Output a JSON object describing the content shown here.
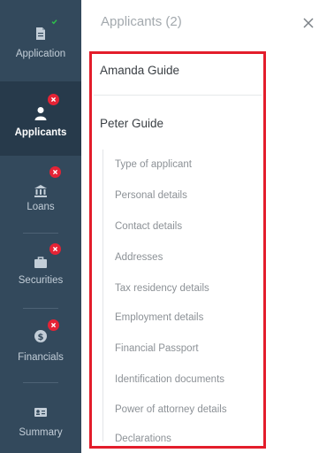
{
  "sidebar": {
    "items": [
      {
        "label": "Application",
        "icon": "document-icon",
        "status": "complete"
      },
      {
        "label": "Applicants",
        "icon": "person-icon",
        "status": "error"
      },
      {
        "label": "Loans",
        "icon": "bank-icon",
        "status": "error"
      },
      {
        "label": "Securities",
        "icon": "briefcase-icon",
        "status": "error"
      },
      {
        "label": "Financials",
        "icon": "money-icon",
        "status": "error"
      },
      {
        "label": "Summary",
        "icon": "id-card-icon",
        "status": "none"
      }
    ]
  },
  "panel": {
    "title": "Applicants (2)",
    "applicants": [
      {
        "name": "Amanda Guide"
      },
      {
        "name": "Peter Guide"
      }
    ],
    "sections": [
      "Type of applicant",
      "Personal details",
      "Contact details",
      "Addresses",
      "Tax residency details",
      "Employment details",
      "Financial Passport",
      "Identification documents",
      "Power of attorney details",
      "Declarations"
    ]
  },
  "colors": {
    "sidebar_bg": "#33495c",
    "sidebar_active_bg": "#273a4b",
    "error_badge": "#e52335",
    "complete_badge": "#2ec54a",
    "highlight_border": "#e31d2b"
  }
}
